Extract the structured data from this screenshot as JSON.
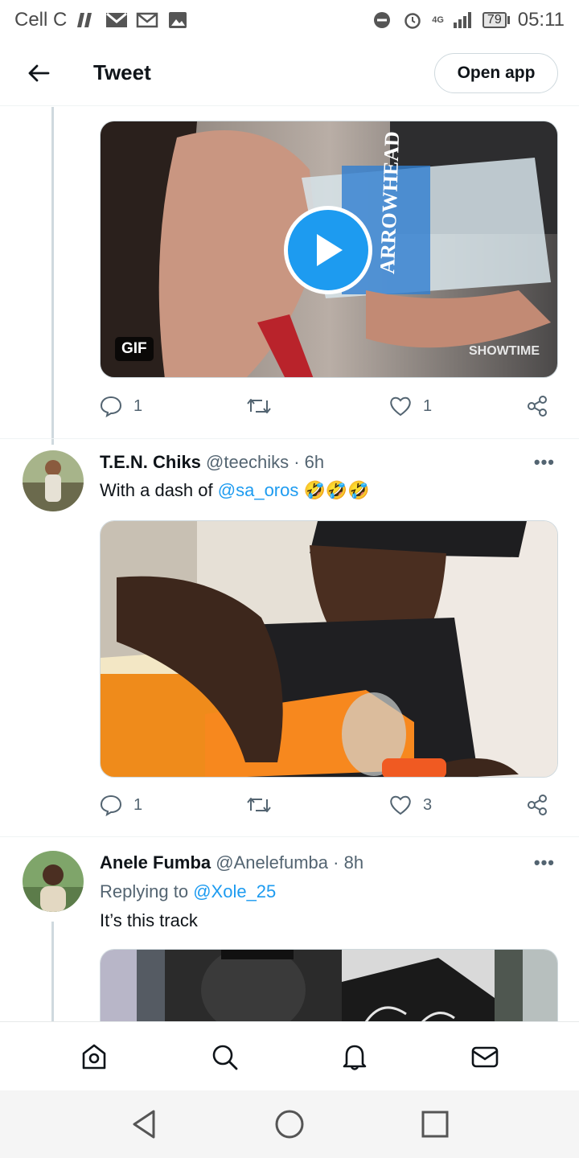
{
  "status_bar": {
    "carrier": "Cell C",
    "network": "4G",
    "battery": "79",
    "time": "05:11",
    "icons": [
      "netflix-icon",
      "mail-icon",
      "gmail-icon",
      "image-icon",
      "dnd-icon",
      "alarm-icon",
      "signal-icon"
    ]
  },
  "header": {
    "title": "Tweet",
    "open_app": "Open app"
  },
  "tweets": [
    {
      "media_type": "GIF",
      "gif_label": "GIF",
      "watermark": "SHOWTIME",
      "bottle_text": "ARROWHEAD",
      "replies": "1",
      "retweets": "",
      "likes": "1"
    },
    {
      "name": "T.E.N. Chiks",
      "handle": "@teechiks",
      "sep": "·",
      "time": "6h",
      "text": "With a dash of",
      "mention": "@sa_oros",
      "emoji": "🤣🤣🤣",
      "replies": "1",
      "retweets": "",
      "likes": "3"
    },
    {
      "name": "Anele Fumba",
      "handle": "@Anelefumba",
      "sep": "·",
      "time": "8h",
      "replying_label": "Replying to",
      "replying_to": "@Xole_25",
      "text": "It’s this track"
    }
  ],
  "colors": {
    "accent": "#1d9bf0",
    "text": "#0f1419",
    "muted": "#536471",
    "border": "#cfd9de"
  }
}
